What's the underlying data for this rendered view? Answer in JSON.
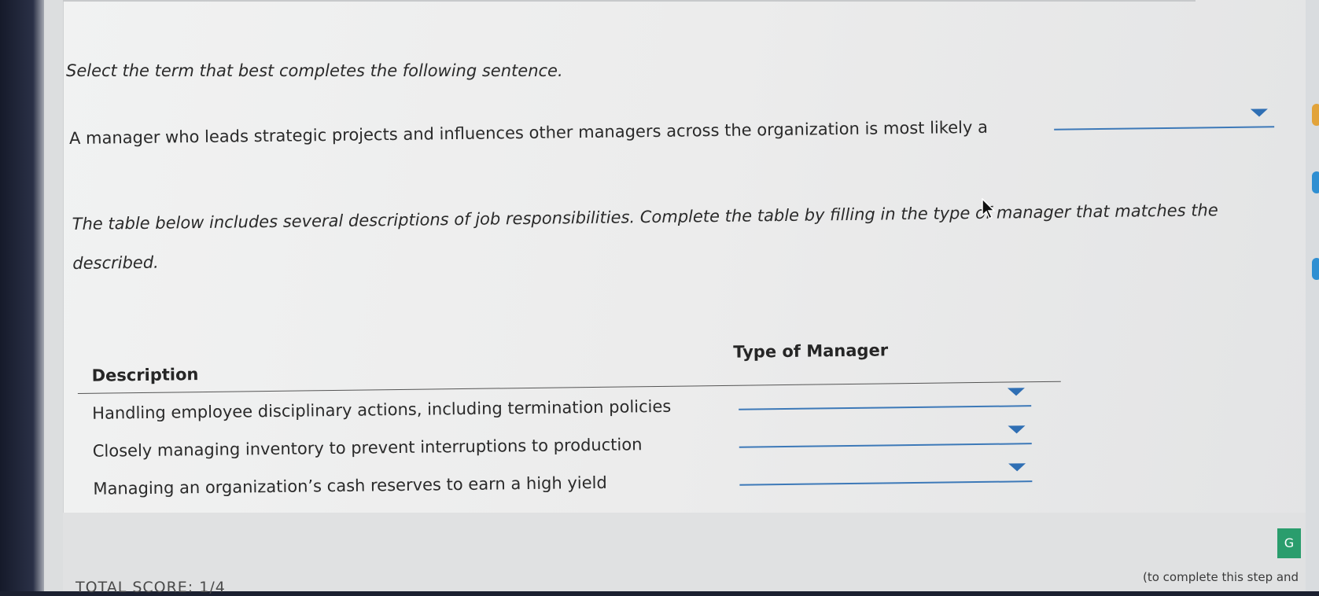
{
  "question": {
    "instruction": "Select the term that best completes the following sentence.",
    "sentence": "A manager who leads strategic projects and influences other managers across the organization is most likely a",
    "dropdown_value": ""
  },
  "table_intro": "The table below includes several descriptions of job responsibilities. Complete the table by filling in the type of manager that matches the described.",
  "table": {
    "header_description": "Description",
    "header_type": "Type of Manager",
    "rows": [
      {
        "description": "Handling employee disciplinary actions, including termination policies",
        "type": ""
      },
      {
        "description": "Closely managing inventory to prevent interruptions to production",
        "type": ""
      },
      {
        "description": "Managing an organization’s cash reserves to earn a high yield",
        "type": ""
      }
    ]
  },
  "footer": {
    "total_score": "TOTAL SCORE: 1/4",
    "hint": "(to complete this step and",
    "button_label": "G"
  },
  "icons": {
    "dropdown": "chevron-down-icon",
    "cursor": "cursor-icon"
  },
  "colors": {
    "accent": "#2f6fb4",
    "button": "#2a9d6d"
  }
}
